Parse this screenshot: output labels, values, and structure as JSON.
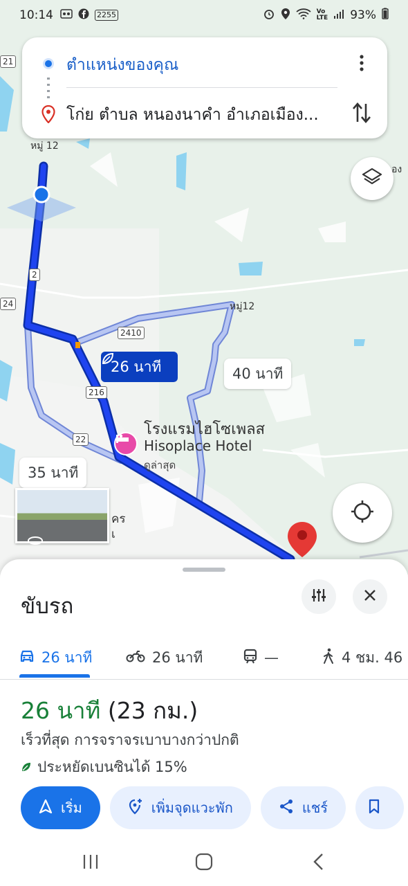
{
  "status_bar": {
    "time": "10:14",
    "extra": "2255",
    "battery": "93%"
  },
  "search": {
    "origin": "ตำแหน่งของคุณ",
    "destination": "โก่ย ตำบล หนองนาคำ อำเภอเมือง..."
  },
  "map": {
    "labels": {
      "village_top": "หมู่ 12",
      "village_right": "หมู่12",
      "edge_top_right": "อง",
      "hotel_thai": "โรงแรมไฮโซเพลส",
      "hotel_en": "Hisoplace Hotel",
      "hotel_sub": "ดูล่าสุด",
      "partial_bottom": "คร",
      "partial_bottom2": "เ"
    },
    "shields": {
      "s21": "21",
      "s24": "24",
      "s2": "2",
      "s2410": "2410",
      "s216": "216",
      "s22": "22"
    },
    "route_tags": {
      "selected": "26 นาที",
      "alt_right": "40 นาที",
      "alt_left": "35 นาที"
    }
  },
  "sheet": {
    "title": "ขับรถ",
    "modes": [
      {
        "label": "26 นาที",
        "icon": "car-icon"
      },
      {
        "label": "26 นาที",
        "icon": "motorcycle-icon"
      },
      {
        "label": "—",
        "icon": "train-icon"
      },
      {
        "label": "4 ชม. 46",
        "icon": "walk-icon"
      }
    ],
    "route": {
      "time": "26 นาที",
      "distance": "(23 กม.)",
      "description": "เร็วที่สุด การจราจรเบาบางกว่าปกติ",
      "eco": "ประหยัดเบนซินได้ 15%"
    },
    "actions": {
      "start": "เริ่ม",
      "add_stop": "เพิ่มจุดแวะพัก",
      "share": "แชร์"
    }
  },
  "colors": {
    "route": "#1a3fe0",
    "alt_route": "#a8b4e6",
    "accent": "#1a73e8",
    "eco_green": "#188038"
  }
}
